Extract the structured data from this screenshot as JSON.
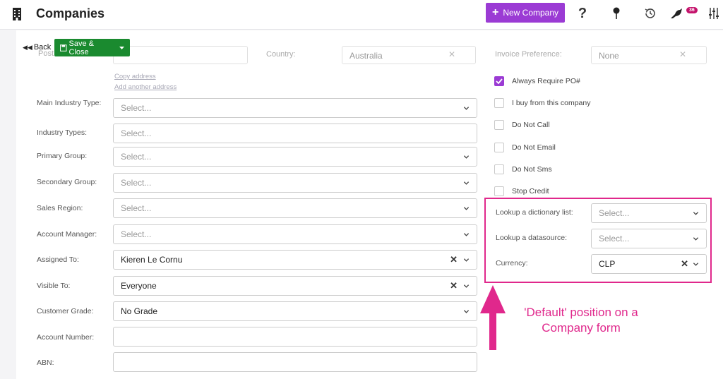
{
  "header": {
    "title": "Companies",
    "new_button_label": "New Company",
    "badge_count": "36"
  },
  "toolbar": {
    "back_label": "Back",
    "save_label": "Save & Close"
  },
  "faded_row": {
    "postcode_label": "Post",
    "country_label": "Country:",
    "country_value": "Australia",
    "invoice_label": "Invoice Preference:",
    "invoice_value": "None"
  },
  "links": {
    "copy_address": "Copy address",
    "add_address": "Add another address"
  },
  "left_fields": [
    {
      "label": "Main Industry Type:",
      "value": "Select...",
      "placeholder": true
    },
    {
      "label": "Industry Types:",
      "value": "Select...",
      "placeholder": true
    },
    {
      "label": "Primary Group:",
      "value": "Select...",
      "placeholder": true
    },
    {
      "label": "Secondary Group:",
      "value": "Select...",
      "placeholder": true
    },
    {
      "label": "Sales Region:",
      "value": "Select...",
      "placeholder": true
    },
    {
      "label": "Account Manager:",
      "value": "Select...",
      "placeholder": true
    },
    {
      "label": "Assigned To:",
      "value": "Kieren Le Cornu",
      "placeholder": false
    },
    {
      "label": "Visible To:",
      "value": "Everyone",
      "placeholder": false
    },
    {
      "label": "Customer Grade:",
      "value": "No Grade",
      "placeholder": false
    },
    {
      "label": "Account Number:",
      "value": "",
      "placeholder": false
    },
    {
      "label": "ABN:",
      "value": "",
      "placeholder": false
    }
  ],
  "checkboxes": [
    {
      "label": "Always Require PO#",
      "checked": true
    },
    {
      "label": "I buy from this company",
      "checked": false
    },
    {
      "label": "Do Not Call",
      "checked": false
    },
    {
      "label": "Do Not Email",
      "checked": false
    },
    {
      "label": "Do Not Sms",
      "checked": false
    },
    {
      "label": "Stop Credit",
      "checked": false
    }
  ],
  "right_fields": [
    {
      "label": "Lookup a dictionary list:",
      "value": "Select...",
      "placeholder": true
    },
    {
      "label": "Lookup a datasource:",
      "value": "Select...",
      "placeholder": true
    },
    {
      "label": "Currency:",
      "value": "CLP",
      "placeholder": false
    }
  ],
  "annotation": {
    "line1": "'Default' position on a",
    "line2": "Company form"
  },
  "colors": {
    "accent": "#9b3bd4",
    "save_green": "#1a8a2f",
    "highlight": "#e0288c",
    "badge": "#c4136c"
  }
}
